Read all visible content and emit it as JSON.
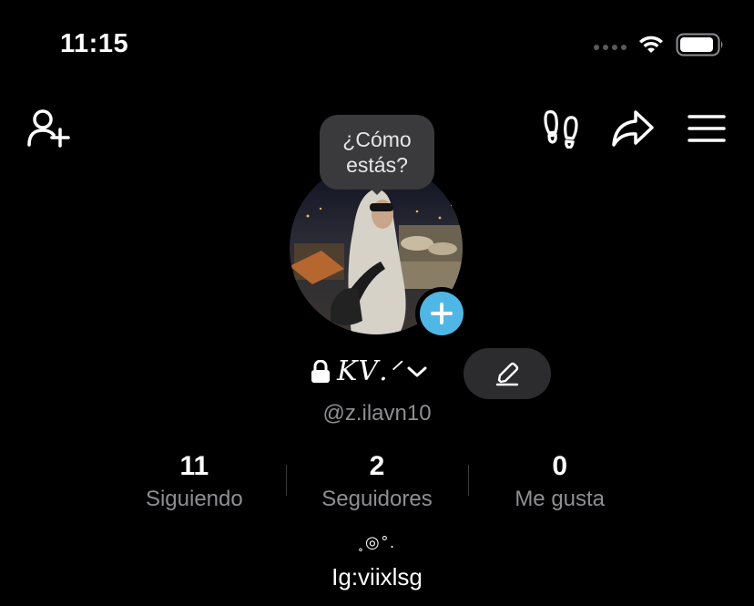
{
  "status_bar": {
    "time": "11:15"
  },
  "icons": {
    "add_friend": "person-add-icon",
    "footprints": "footprints-icon",
    "share": "share-arrow-icon",
    "menu": "hamburger-menu-icon",
    "lock": "lock-icon",
    "chevron": "chevron-down-icon",
    "edit": "pencil-icon",
    "add_story": "plus-icon"
  },
  "tooltip": {
    "text": "¿Cómo\nestás?"
  },
  "profile": {
    "display_name": "𝐾𝑉.ᐟ",
    "handle": "@z.ilavn10"
  },
  "stats": [
    {
      "value": "11",
      "label": "Siguiendo"
    },
    {
      "value": "2",
      "label": "Seguidores"
    },
    {
      "value": "0",
      "label": "Me gusta"
    }
  ],
  "bio": {
    "decoration": "˳◎°.",
    "text": "Ig:viixlsg"
  },
  "colors": {
    "background": "#000000",
    "accent_blue": "#4fb7e6",
    "secondary_text": "#8e8e93",
    "pill_bg": "#2c2c2e",
    "tooltip_bg": "#3a3a3c"
  }
}
